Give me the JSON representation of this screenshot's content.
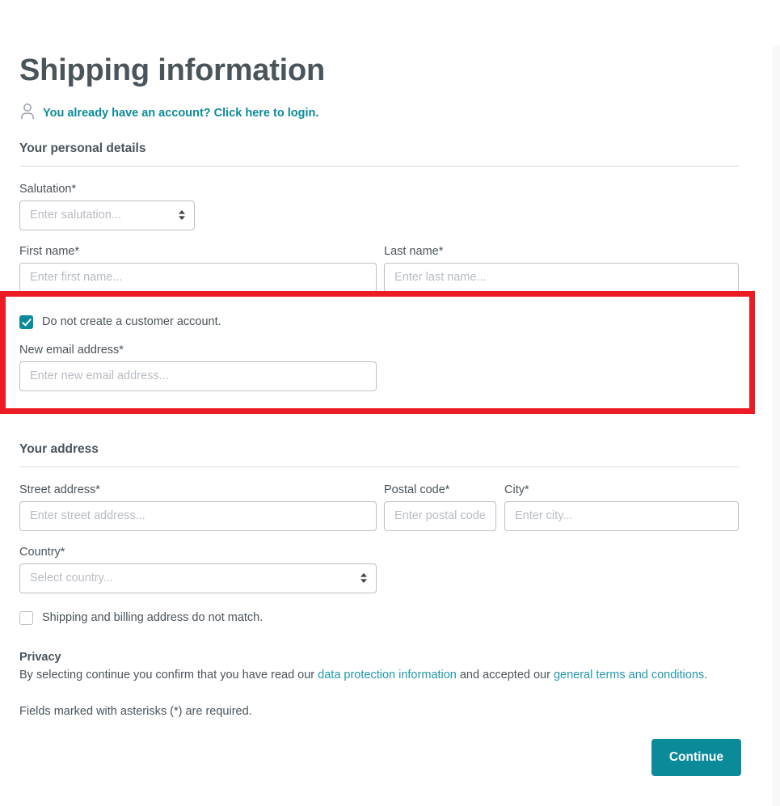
{
  "page": {
    "title": "Shipping information",
    "login_prompt": "You already have an account? Click here to login.",
    "person_icon": "person-icon"
  },
  "colors": {
    "accent": "#0b8b99",
    "link": "#2196ad",
    "text": "#4a545b",
    "border": "#bcc1c7",
    "highlight": "#ec1c24"
  },
  "personal_details": {
    "heading": "Your personal details",
    "salutation": {
      "label": "Salutation*",
      "placeholder": "Enter salutation...",
      "value": "",
      "options": [
        "Enter salutation..."
      ]
    },
    "first_name": {
      "label": "First name*",
      "placeholder": "Enter first name...",
      "value": ""
    },
    "last_name": {
      "label": "Last name*",
      "placeholder": "Enter last name...",
      "value": ""
    }
  },
  "account": {
    "no_account_checkbox": {
      "label": "Do not create a customer account.",
      "checked": true
    },
    "email": {
      "label": "New email address*",
      "placeholder": "Enter new email address...",
      "value": ""
    }
  },
  "address": {
    "heading": "Your address",
    "street": {
      "label": "Street address*",
      "placeholder": "Enter street address...",
      "value": ""
    },
    "postal_code": {
      "label": "Postal code*",
      "placeholder": "Enter postal code.",
      "value": ""
    },
    "city": {
      "label": "City*",
      "placeholder": "Enter city...",
      "value": ""
    },
    "country": {
      "label": "Country*",
      "placeholder": "Select country...",
      "value": "",
      "options": [
        "Select country..."
      ]
    },
    "billing_mismatch_checkbox": {
      "label": "Shipping and billing address do not match.",
      "checked": false
    }
  },
  "privacy": {
    "title": "Privacy",
    "text_part_1": "By selecting continue you confirm that you have read our ",
    "link_1": "data protection information",
    "text_part_2": " and accepted our ",
    "link_2": "general terms and conditions",
    "text_part_3": ".",
    "required_note": "Fields marked with asterisks (*) are required."
  },
  "actions": {
    "continue_label": "Continue"
  }
}
